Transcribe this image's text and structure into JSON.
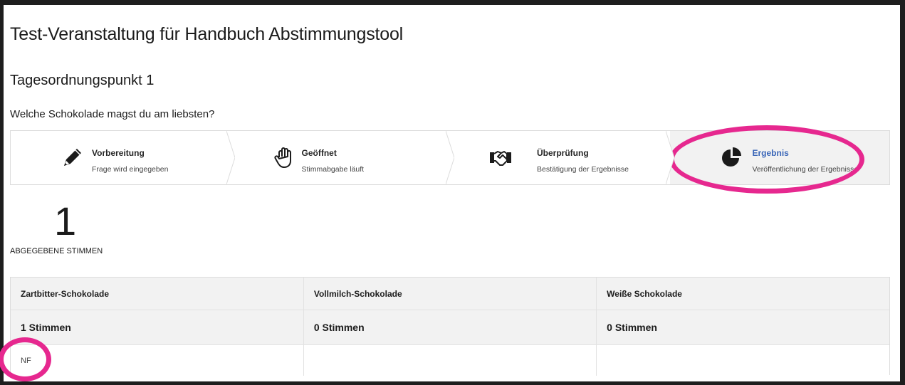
{
  "event_title": "Test-Veranstaltung für Handbuch Abstimmungstool",
  "agenda_item": "Tagesordnungspunkt 1",
  "question": "Welche Schokolade magst du am liebsten?",
  "steps": [
    {
      "label": "Vorbereitung",
      "description": "Frage wird eingegeben",
      "icon": "pencil-icon"
    },
    {
      "label": "Geöffnet",
      "description": "Stimmabgabe läuft",
      "icon": "hand-icon"
    },
    {
      "label": "Überprüfung",
      "description": "Bestätigung der Ergebnisse",
      "icon": "handshake-icon"
    },
    {
      "label": "Ergebnis",
      "description": "Veröffentlichung der Ergebnisse",
      "icon": "pie-chart-icon"
    }
  ],
  "active_step": "Ergebnis",
  "votes": {
    "count": "1",
    "label": "ABGEGEBENE STIMMEN"
  },
  "results": {
    "options": [
      {
        "name": "Zartbitter-Schokolade",
        "votes": "1 Stimmen",
        "voters": "NF"
      },
      {
        "name": "Vollmilch-Schokolade",
        "votes": "0 Stimmen",
        "voters": ""
      },
      {
        "name": "Weiße Schokolade",
        "votes": "0 Stimmen",
        "voters": ""
      }
    ]
  },
  "colors": {
    "active_step_label": "#3a66b8",
    "highlight": "#e6288f",
    "active_step_bg": "#f2f2f2"
  }
}
